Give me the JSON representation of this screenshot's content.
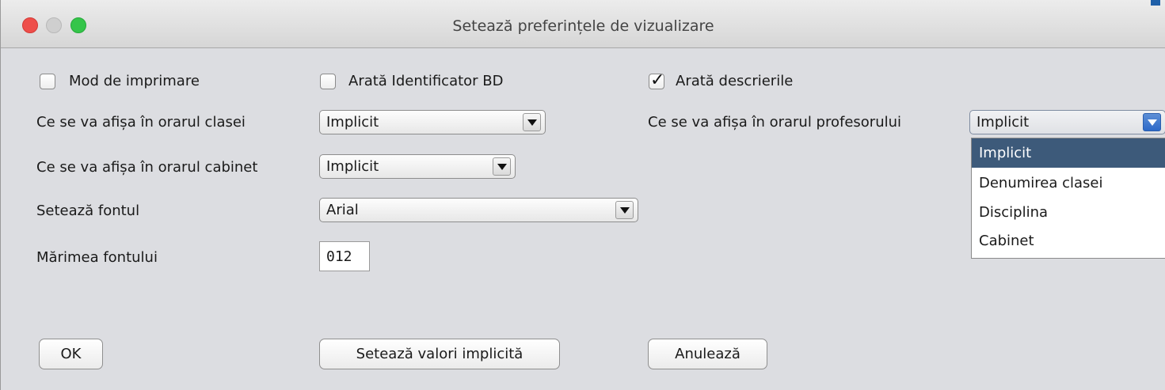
{
  "window": {
    "title": "Setează preferințele de vizualizare"
  },
  "checkboxes": {
    "print_mode": {
      "label": "Mod de imprimare",
      "checked": false
    },
    "show_db_id": {
      "label": "Arată Identificator BD",
      "checked": false
    },
    "show_descriptions": {
      "label": "Arată descrierile",
      "checked": true,
      "mark": "✓"
    }
  },
  "rows": {
    "class_timetable": {
      "label": "Ce se va afișa în orarul clasei",
      "value": "Implicit"
    },
    "teacher_timetable": {
      "label": "Ce se va afișa în orarul profesorului",
      "value": "Implicit"
    },
    "room_timetable": {
      "label": "Ce se va afișa în orarul cabinet",
      "value": "Implicit"
    },
    "font": {
      "label": "Setează fontul",
      "value": "Arial"
    },
    "font_size": {
      "label": "Mărimea fontului",
      "value": "012"
    }
  },
  "dropdown": {
    "options": [
      "Implicit",
      "Denumirea clasei",
      "Disciplina",
      "Cabinet"
    ],
    "selected": "Implicit"
  },
  "buttons": {
    "ok": "OK",
    "set_defaults": "Setează valori implicită",
    "cancel": "Anulează"
  },
  "colors": {
    "window_bg": "#dcdde1",
    "selected_item_bg": "#3d5a7a",
    "accent": "#2d69c8"
  }
}
